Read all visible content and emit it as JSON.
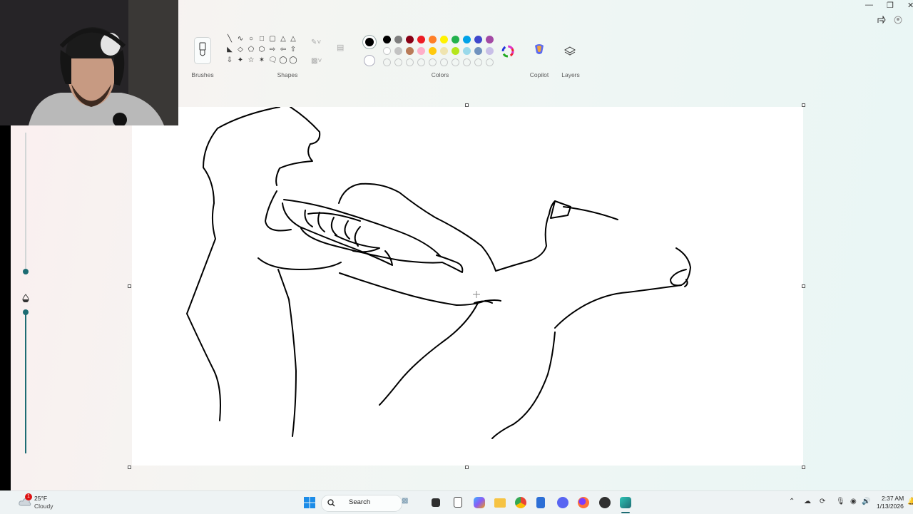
{
  "ribbon": {
    "brushes_label": "Brushes",
    "shapes_label": "Shapes",
    "colors_label": "Colors",
    "copilot_label": "Copilot",
    "layers_label": "Layers"
  },
  "palette": {
    "row1": [
      "#000000",
      "#7f7f7f",
      "#880015",
      "#ed1c24",
      "#ff7f27",
      "#fff200",
      "#22b14c",
      "#00a2e8",
      "#3f48cc",
      "#a349a4"
    ],
    "row2": [
      "#ffffff",
      "#c3c3c3",
      "#b97a57",
      "#ffaec9",
      "#ffc90e",
      "#efe4b0",
      "#b5e61d",
      "#99d9ea",
      "#7092be",
      "#c8bfe7"
    ],
    "selected_primary": "#000000",
    "selected_secondary": "#ffffff"
  },
  "icons": {
    "brush": "brush-icon",
    "copilot": "copilot-icon",
    "layers": "layers-icon",
    "edit_colors": "color-wheel-icon"
  },
  "taskbar": {
    "weather_temp": "25°F",
    "weather_desc": "Cloudy",
    "weather_badge": "1",
    "search_label": "Search",
    "time": "2:37 AM",
    "date": "1/13/2026"
  },
  "accent": "#1d6c73"
}
